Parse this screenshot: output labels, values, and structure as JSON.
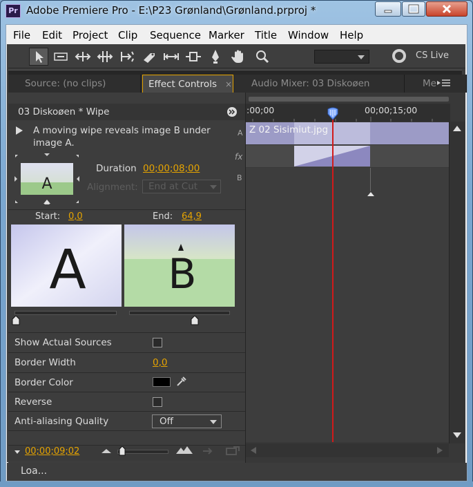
{
  "window": {
    "title": "Adobe Premiere Pro - E:\\P23 Grønland\\Grønland.prproj *",
    "app_icon_label": "Pr",
    "controls": [
      "minimize",
      "maximize",
      "close"
    ]
  },
  "menu": [
    "File",
    "Edit",
    "Project",
    "Clip",
    "Sequence",
    "Marker",
    "Title",
    "Window",
    "Help"
  ],
  "toolbar": {
    "tools": [
      "selection-tool",
      "track-select-tool",
      "ripple-edit-tool",
      "rolling-edit-tool",
      "rate-stretch-tool",
      "razor-tool",
      "slip-tool",
      "slide-tool",
      "pen-tool",
      "hand-tool",
      "zoom-tool"
    ],
    "workspace_value": "",
    "cs_live_label": "CS Live"
  },
  "tabs": [
    {
      "label": "Source: (no clips)",
      "active": false
    },
    {
      "label": "Effect Controls",
      "active": true
    },
    {
      "label": "Audio Mixer: 03 Diskoøen",
      "active": false
    },
    {
      "label": "Me",
      "active": false
    }
  ],
  "effect_controls": {
    "clip_header": "03 Diskoøen * Wipe",
    "description": [
      "A moving wipe reveals image B under",
      "image A."
    ],
    "duration_label": "Duration",
    "duration_value": "00;00;08;00",
    "alignment_label": "Alignment:",
    "alignment_value": "End at Cut",
    "start_label": "Start:",
    "start_value": "0,0",
    "end_label": "End:",
    "end_value": "64,9",
    "thumb_a_letter": "A",
    "thumb_b_letter": "B",
    "track_letters": {
      "a": "A",
      "fx": "fx",
      "b": "B"
    },
    "params": [
      {
        "label": "Show Actual Sources",
        "control": "checkbox"
      },
      {
        "label": "Border Width",
        "value": "0,0"
      },
      {
        "label": "Border Color",
        "color": "#000000"
      },
      {
        "label": "Reverse",
        "control": "checkbox"
      },
      {
        "label": "Anti-aliasing Quality",
        "value": "Off"
      }
    ],
    "current_time": "00;00;09;02"
  },
  "timeline": {
    "ruler_labels": [
      ":00;00",
      "00;00;15;00"
    ],
    "clip_a_label": "Z 02 Sisimiut.jpg"
  },
  "status": {
    "text": "Loa..."
  },
  "colors": {
    "accent": "#e6a400",
    "playhead": "#d21a1a",
    "clip": "#9c9bc6",
    "panel": "#3d3d3d"
  }
}
